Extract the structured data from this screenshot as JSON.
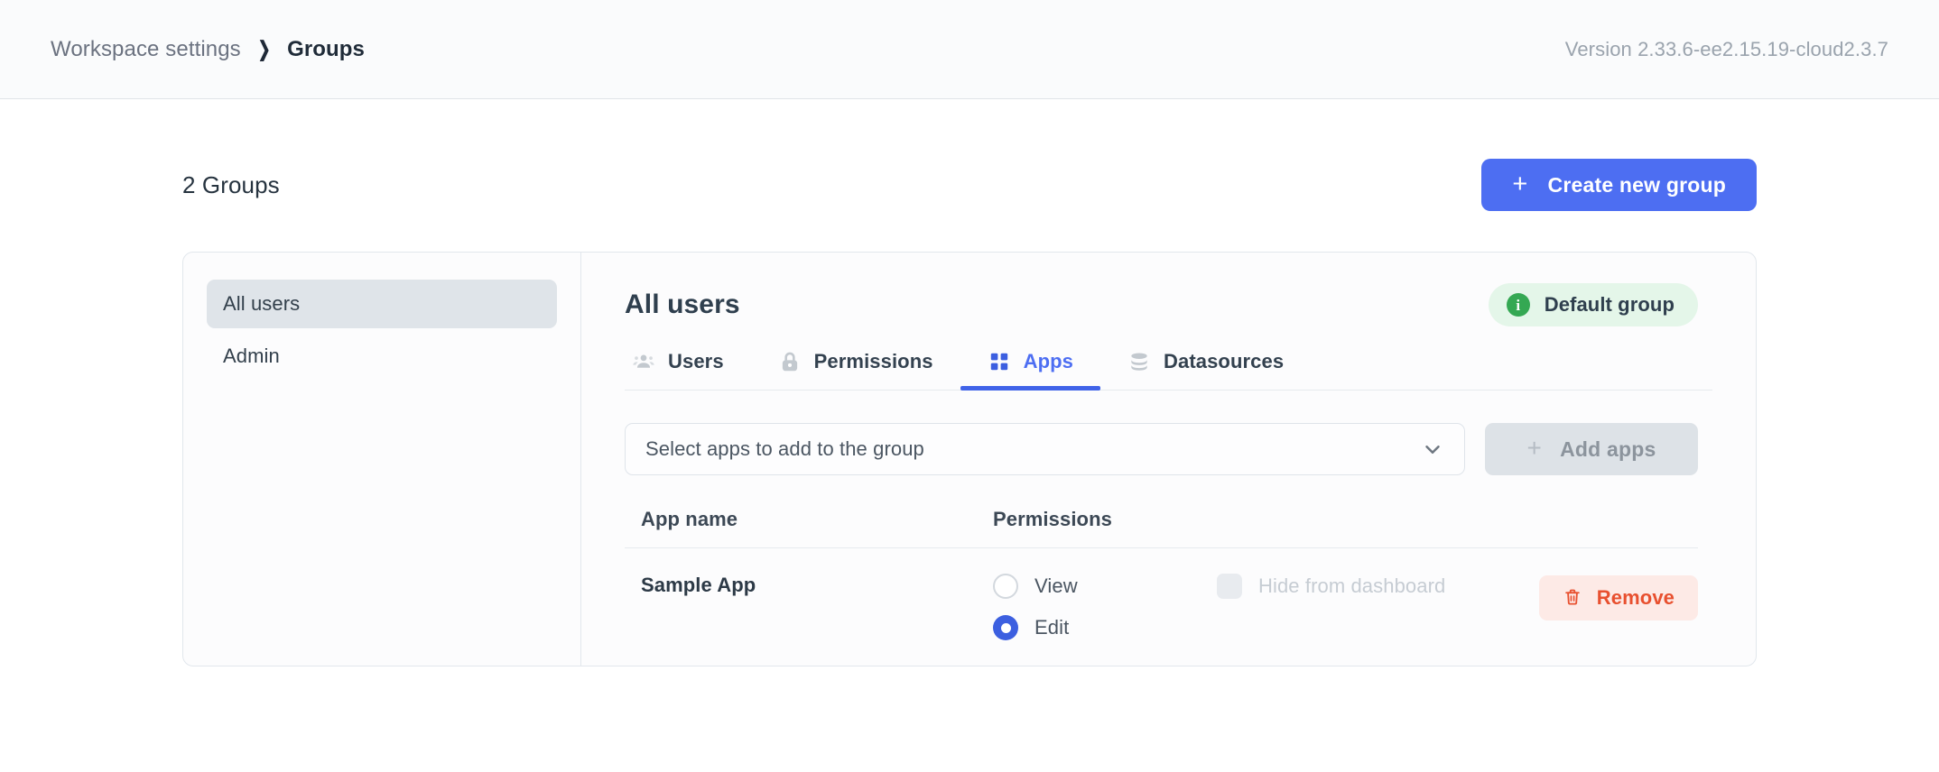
{
  "header": {
    "breadcrumb": {
      "parent": "Workspace settings",
      "separator": "❯",
      "current": "Groups"
    },
    "version": "Version 2.33.6-ee2.15.19-cloud2.3.7"
  },
  "toolbar": {
    "groups_count": "2 Groups",
    "create_group_label": "Create new group",
    "create_group_plus": "+"
  },
  "group_list": {
    "items": [
      {
        "label": "All users",
        "active": true
      },
      {
        "label": "Admin",
        "active": false
      }
    ]
  },
  "panel": {
    "title": "All users",
    "badge": {
      "icon_glyph": "i",
      "label": "Default group",
      "bg_color": "#e4f6e9",
      "icon_color": "#34a853"
    },
    "tabs": [
      {
        "label": "Users",
        "icon": "users-icon",
        "active": false
      },
      {
        "label": "Permissions",
        "icon": "lock-icon",
        "active": false
      },
      {
        "label": "Apps",
        "icon": "apps-grid-icon",
        "active": true
      },
      {
        "label": "Datasources",
        "icon": "database-icon",
        "active": false
      }
    ],
    "active_tab_color": "#4d6ef2",
    "add_row": {
      "select_value": "Select apps to add to the group",
      "select_placeholder": "Select apps to add to the group",
      "chevron_icon": "chevron-down-icon",
      "add_button_label": "Add apps",
      "add_button_plus": "+",
      "add_button_disabled": true
    },
    "table": {
      "columns": [
        "App name",
        "Permissions"
      ],
      "rows": [
        {
          "app_name": "Sample App",
          "permissions": [
            {
              "label": "View",
              "checked": false
            },
            {
              "label": "Edit",
              "checked": true
            }
          ],
          "hide_from_dashboard": {
            "label": "Hide from dashboard",
            "checked": false,
            "disabled": true
          },
          "remove_label": "Remove",
          "remove_icon": "trash-icon"
        }
      ]
    }
  },
  "colors": {
    "brand_blue": "#4d6ef2",
    "tab_underline": "#4063e8",
    "danger": "#e8502f",
    "danger_bg": "#fdeae6",
    "disabled_bg": "#dde2e7",
    "green": "#34a853"
  }
}
